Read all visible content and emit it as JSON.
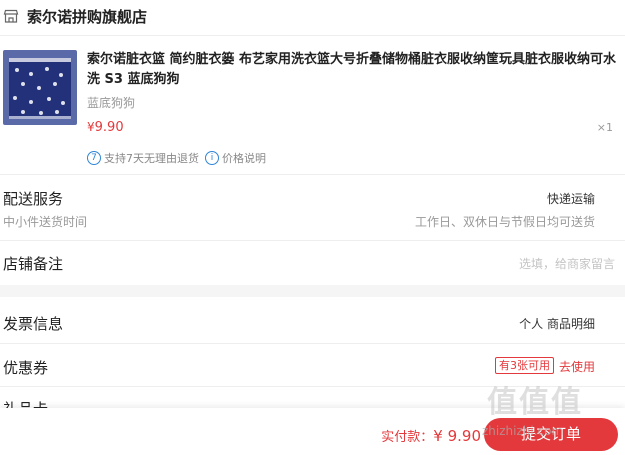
{
  "shop": {
    "name": "索尔诺拼购旗舰店",
    "icon": "store-icon"
  },
  "product": {
    "title": "索尔诺脏衣篮 简约脏衣篓 布艺家用洗衣篮大号折叠储物桶脏衣服收纳筐玩具脏衣服收纳可水洗 S3 蓝底狗狗",
    "variant": "蓝底狗狗",
    "price_currency": "¥",
    "price_value": "9.90",
    "quantity": "×1",
    "badges": [
      {
        "icon_text": "7",
        "label": "支持7天无理由退货"
      },
      {
        "icon_text": "i",
        "label": "价格说明"
      }
    ]
  },
  "delivery": {
    "label": "配送服务",
    "sub": "中小件送货时间",
    "method": "快递运输",
    "time": "工作日、双休日与节假日均可送货"
  },
  "remark": {
    "label": "店铺备注",
    "placeholder": "选填，给商家留言"
  },
  "invoice": {
    "label": "发票信息",
    "value": "个人 商品明细"
  },
  "coupon": {
    "label": "优惠券",
    "badge": "有3张可用",
    "action": "去使用"
  },
  "partial_row": {
    "label": "礼品卡"
  },
  "footer": {
    "pay_label": "实付款：",
    "pay_amount": "¥ 9.90",
    "submit_label": "提交订单"
  },
  "watermark": {
    "logo_text": "值值值",
    "url": "zhizhizhi.com"
  },
  "colors": {
    "accent": "#e4393c",
    "link_blue": "#2f86d6",
    "muted": "#999999"
  }
}
